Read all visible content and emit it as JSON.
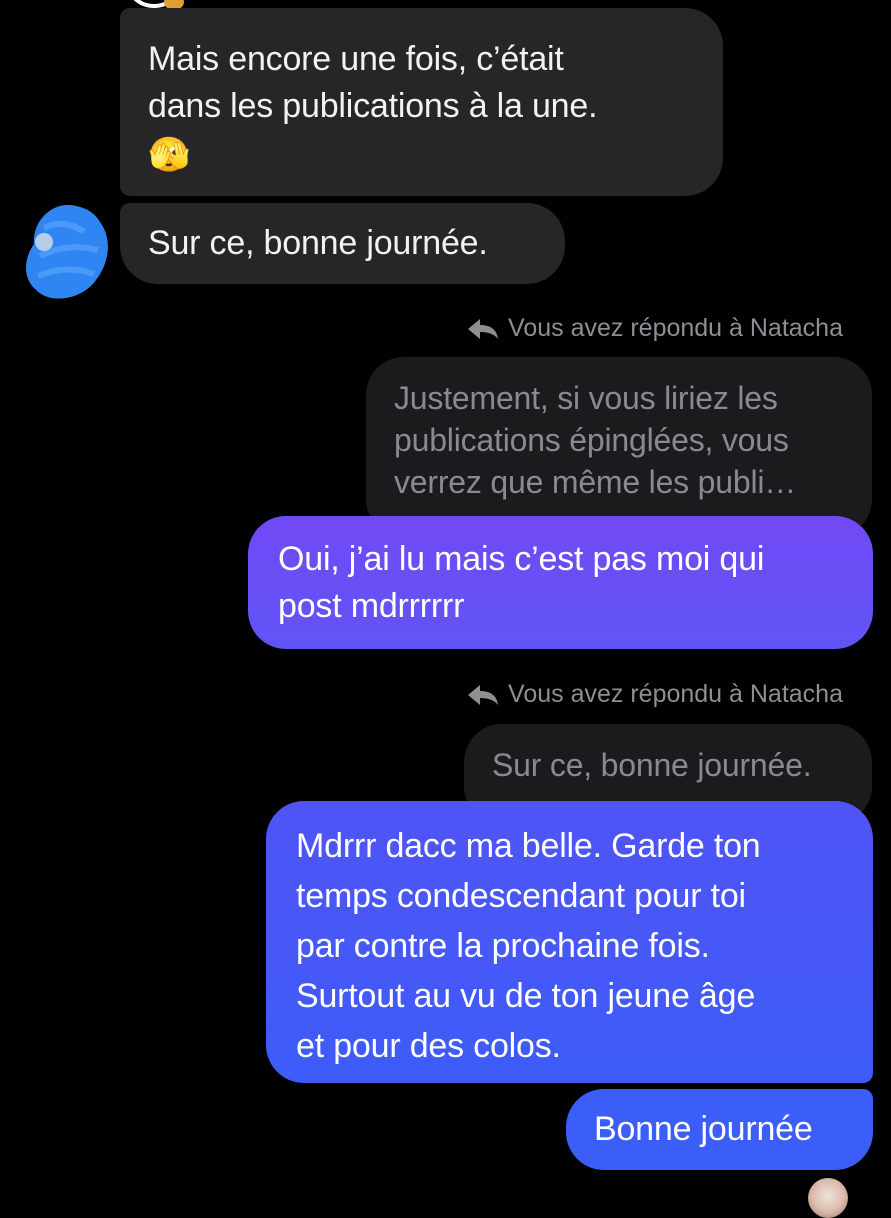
{
  "messages": {
    "incoming_1": {
      "lines": [
        "Mais encore une fois, c’était",
        "dans les publications à la une."
      ],
      "emoji": "🫣"
    },
    "incoming_2": {
      "text": "Sur ce, bonne journée."
    },
    "reply_1": {
      "note": "Vous avez répondu à Natacha",
      "quoted_lines": [
        "Justement, si vous liriez les",
        "publications épinglées, vous",
        "verrez que même les publi…"
      ],
      "reply_lines": [
        "Oui, j’ai lu mais c’est pas moi qui",
        "post mdrrrrrr"
      ]
    },
    "reply_2": {
      "note": "Vous avez répondu à Natacha",
      "quoted_text": "Sur ce, bonne journée.",
      "reply_lines": [
        "Mdrrr dacc ma belle. Garde ton",
        "temps condescendant pour toi",
        "par contre la prochaine fois.",
        "Surtout au vu de ton jeune âge",
        "et pour des colos."
      ]
    },
    "outgoing_last": {
      "text": "Bonne journée"
    }
  },
  "colors": {
    "background": "#000000",
    "incoming_bubble": "#262628",
    "quoted_bubble": "#1b1b1d",
    "outgoing_purple": "#6f4cf6",
    "outgoing_blue": "#3d5cf7",
    "meta_text": "#8e8e93",
    "redaction_blue": "#2f86f2"
  },
  "icons": {
    "reply": "reply-arrow-icon",
    "avatar": "avatar-redacted"
  }
}
